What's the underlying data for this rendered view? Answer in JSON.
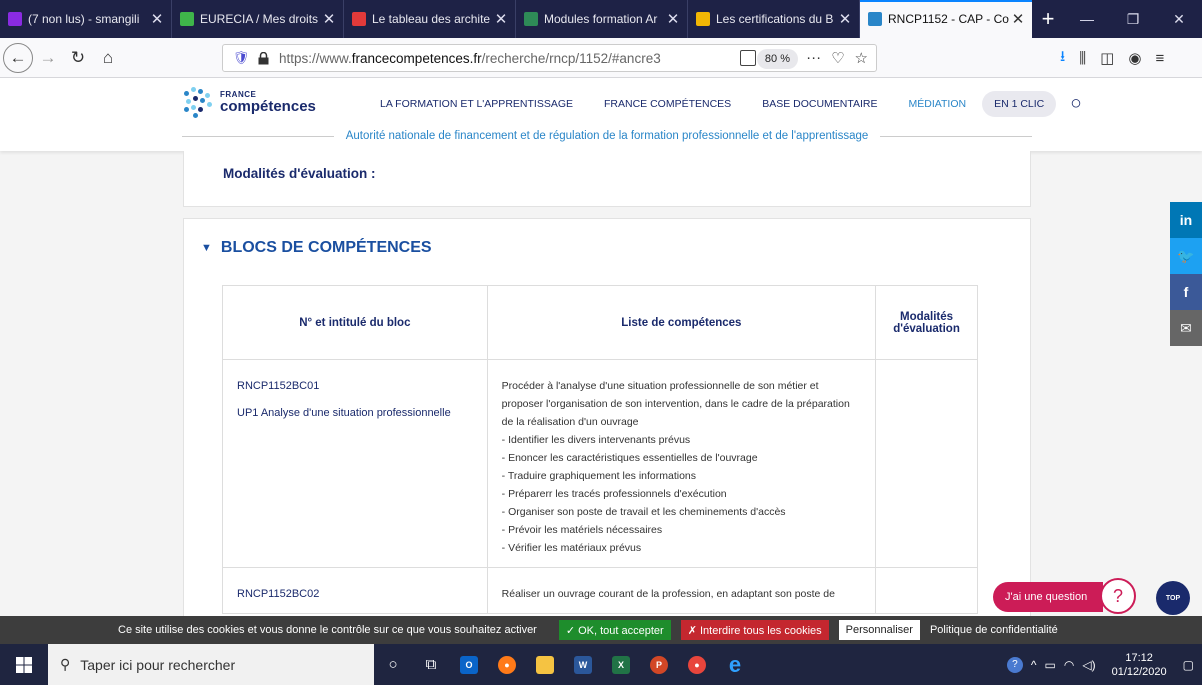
{
  "browser": {
    "tabs": [
      {
        "label": "(7 non lus) - smangili",
        "color": "#8a2be2"
      },
      {
        "label": "EURECIA / Mes droits",
        "color": "#3fb54a"
      },
      {
        "label": "Le tableau des archite",
        "color": "#e23a3a"
      },
      {
        "label": "Modules formation Ar",
        "color": "#2e8b57"
      },
      {
        "label": "Les certifications du B",
        "color": "#f2b705"
      },
      {
        "label": "RNCP1152 - CAP - Co",
        "color": "#2a86c8"
      }
    ],
    "active_tab": 5,
    "url_prefix": "https://www.",
    "url_domain": "francecompetences.fr",
    "url_path": "/recherche/rncp/1152/#ancre3",
    "zoom": "80 %"
  },
  "site": {
    "logo_small": "FRANCE",
    "logo_big": "compétences",
    "nav": [
      "LA FORMATION ET L'APPRENTISSAGE",
      "FRANCE COMPÉTENCES",
      "BASE DOCUMENTAIRE",
      "MÉDIATION"
    ],
    "nav_clic": "EN 1 CLIC",
    "tagline": "Autorité nationale de financement et de régulation de la formation professionnelle et de l'apprentissage"
  },
  "content": {
    "modalites_heading": "Modalités d'évaluation :",
    "blocs_heading": "BLOCS DE COMPÉTENCES",
    "table": {
      "headers": [
        "N° et intitulé du bloc",
        "Liste de compétences",
        "Modalités d'évaluation"
      ],
      "rows": [
        {
          "code": "RNCP1152BC01",
          "title": "UP1 Analyse d'une situation professionnelle",
          "intro": "Procéder à l'analyse d'une situation professionnelle de son métier et proposer l'organisation de son intervention, dans le cadre de la préparation de la réalisation d'un ouvrage",
          "items": [
            "- Identifier les divers intervenants prévus",
            "- Enoncer les caractéristiques essentielles de l'ouvrage",
            "- Traduire graphiquement les informations",
            "- Préparerr les tracés professionnels d'exécution",
            "- Organiser son poste de travail et les cheminements d'accès",
            "- Prévoir les matériels nécessaires",
            "- Vérifier les matériaux prévus"
          ]
        },
        {
          "code": "RNCP1152BC02",
          "title": "",
          "intro": "Réaliser un ouvrage courant de la profession, en adaptant son poste de",
          "items": []
        }
      ]
    }
  },
  "social": [
    {
      "icon": "linkedin-icon",
      "label": "in",
      "color": "#0077b5"
    },
    {
      "icon": "twitter-icon",
      "label": "🐦",
      "color": "#1da1f2"
    },
    {
      "icon": "facebook-icon",
      "label": "f",
      "color": "#3b5998"
    },
    {
      "icon": "mail-icon",
      "label": "✉",
      "color": "#666666"
    }
  ],
  "help": {
    "label": "J'ai une question",
    "top_label": "TOP"
  },
  "cookies": {
    "message": "Ce site utilise des cookies et vous donne le contrôle sur ce que vous souhaitez activer",
    "accept": "✓ OK, tout accepter",
    "deny": "✗ Interdire tous les cookies",
    "personalize": "Personnaliser",
    "policy": "Politique de confidentialité"
  },
  "taskbar": {
    "search_placeholder": "Taper ici pour rechercher",
    "time": "17:12",
    "date": "01/12/2020"
  }
}
